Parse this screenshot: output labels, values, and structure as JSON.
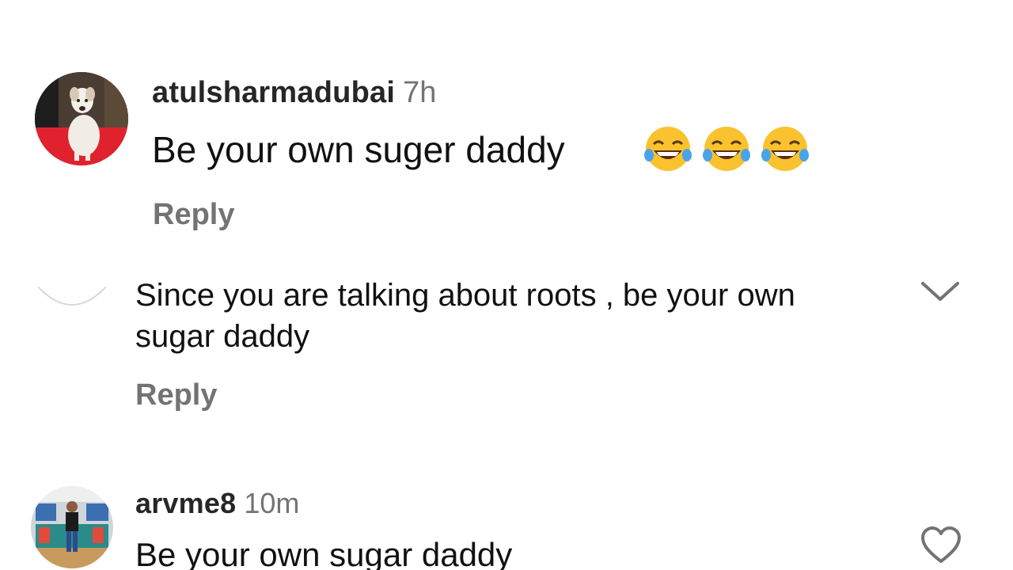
{
  "comments": [
    {
      "username": "atulsharmadubai",
      "time": "7h",
      "text": "Be your own suger daddy",
      "emojis": [
        "face-with-tears-of-joy",
        "face-with-tears-of-joy",
        "face-with-tears-of-joy"
      ],
      "reply": "Reply"
    },
    {
      "text": "Since you are talking about roots , be your own sugar daddy",
      "reply": "Reply",
      "icon": "chevron-down-icon"
    },
    {
      "username": "arvme8",
      "time": "10m",
      "text": "Be your own sugar daddy",
      "icon": "heart-icon"
    }
  ],
  "colors": {
    "username": "#262626",
    "secondary": "#737373",
    "text": "#111111",
    "background": "#ffffff"
  }
}
